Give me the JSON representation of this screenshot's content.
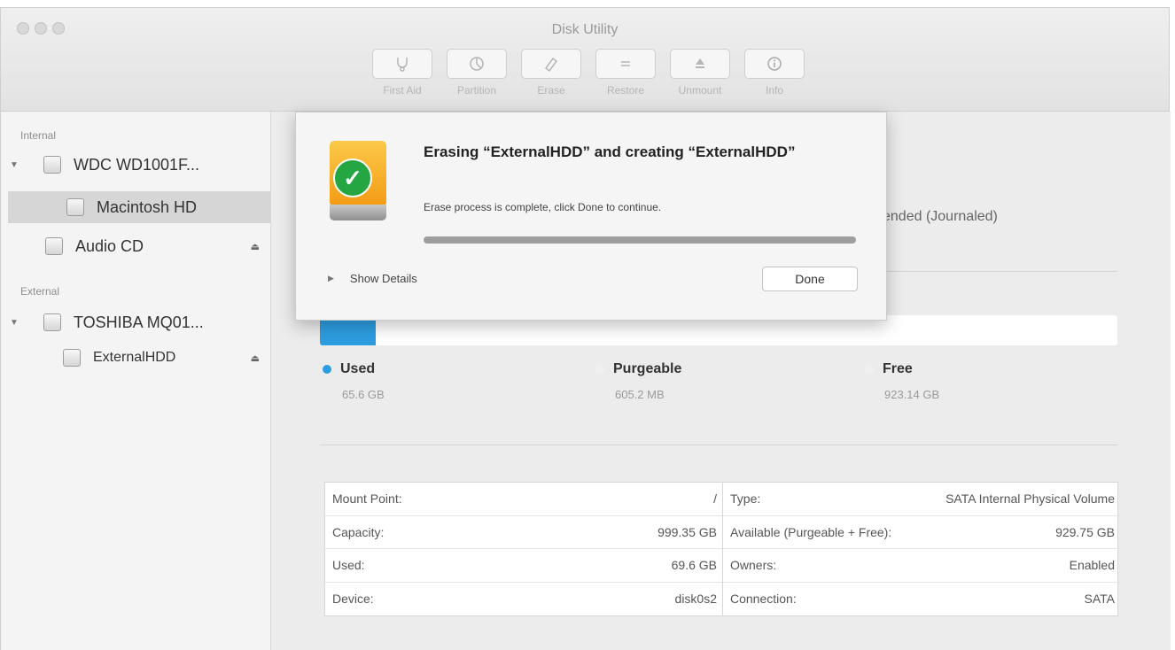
{
  "window": {
    "title": "Disk Utility"
  },
  "toolbar": {
    "items": [
      {
        "label": "First Aid",
        "icon": "stethoscope-icon"
      },
      {
        "label": "Partition",
        "icon": "partition-pie-icon"
      },
      {
        "label": "Erase",
        "icon": "erase-icon"
      },
      {
        "label": "Restore",
        "icon": "restore-icon"
      },
      {
        "label": "Unmount",
        "icon": "unmount-icon"
      },
      {
        "label": "Info",
        "icon": "info-icon"
      }
    ]
  },
  "sidebar": {
    "internal_header": "Internal",
    "external_header": "External",
    "items": [
      {
        "label": "WDC WD1001F..."
      },
      {
        "label": "Macintosh HD"
      },
      {
        "label": "Audio CD"
      },
      {
        "label": "TOSHIBA MQ01..."
      },
      {
        "label": "ExternalHDD"
      }
    ]
  },
  "main": {
    "filesystem_partial": "ended (Journaled)",
    "usage": {
      "used_fraction": 0.07
    },
    "legend": [
      {
        "name": "Used",
        "value": "65.6 GB",
        "color": "#2d9de0"
      },
      {
        "name": "Purgeable",
        "value": "605.2 MB",
        "color": "#f0f0f0"
      },
      {
        "name": "Free",
        "value": "923.14 GB",
        "color": "#f0f0f0"
      }
    ],
    "info_left": [
      {
        "label": "Mount Point:",
        "value": "/"
      },
      {
        "label": "Capacity:",
        "value": "999.35 GB"
      },
      {
        "label": "Used:",
        "value": "69.6 GB"
      },
      {
        "label": "Device:",
        "value": "disk0s2"
      }
    ],
    "info_right": [
      {
        "label": "Type:",
        "value": "SATA Internal Physical Volume"
      },
      {
        "label": "Available (Purgeable + Free):",
        "value": "929.75 GB"
      },
      {
        "label": "Owners:",
        "value": "Enabled"
      },
      {
        "label": "Connection:",
        "value": "SATA"
      }
    ]
  },
  "dialog": {
    "title": "Erasing “ExternalHDD” and creating “ExternalHDD”",
    "message": "Erase process is complete, click Done to continue.",
    "progress": 1.0,
    "show_details": "Show Details",
    "done_label": "Done"
  }
}
